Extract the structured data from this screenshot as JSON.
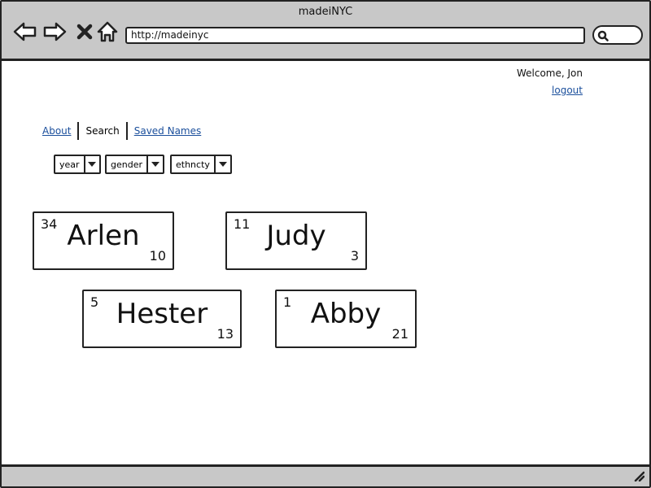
{
  "window": {
    "title": "madeiNYC"
  },
  "toolbar": {
    "url": "http://madeinyc"
  },
  "user": {
    "welcome": "Welcome, Jon",
    "logout": "logout"
  },
  "nav": {
    "about": "About",
    "search": "Search",
    "saved": "Saved Names"
  },
  "filters": {
    "year": "year",
    "gender": "gender",
    "ethnicity": "ethncty"
  },
  "cards": [
    {
      "top": "34",
      "name": "Arlen",
      "bottom": "10"
    },
    {
      "top": "11",
      "name": "Judy",
      "bottom": "3"
    },
    {
      "top": "5",
      "name": "Hester",
      "bottom": "13"
    },
    {
      "top": "1",
      "name": "Abby",
      "bottom": "21"
    }
  ],
  "colors": {
    "chrome": "#c8c8c8",
    "link": "#1b4f9c",
    "border": "#222222"
  }
}
